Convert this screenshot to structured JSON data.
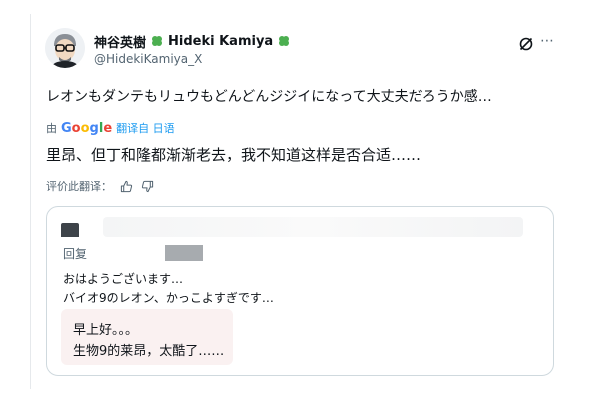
{
  "author": {
    "display_name": "神谷英樹",
    "display_name_suffix": "Hideki Kamiya",
    "handle": "@HidekiKamiya_X"
  },
  "icons": {
    "avatar": "avatar-illustration",
    "clover": "four-leaf-clover-icon",
    "grok": "grok-slash-icon",
    "more": "more-icon",
    "thumbs_up": "thumbs-up-icon",
    "thumbs_down": "thumbs-down-icon"
  },
  "post": {
    "original_text": "レオンもダンテもリュウもどんどんジジイになって大丈夫だろうか感…",
    "translate_by": "由",
    "translate_provider": "Google",
    "translate_link": "翻译自 日语",
    "translated_text": "里昂、但丁和隆都渐渐老去，我不知道这样是否合适……",
    "rate_label": "评价此翻译："
  },
  "quote": {
    "reply_label": "回复",
    "line1": "おはようございます…",
    "line2": "バイオ9のレオン、かっこよすぎです…",
    "translation_line1": "早上好。。。",
    "translation_line2": "生物9的莱昂，太酷了……"
  },
  "colors": {
    "link": "#1d9bf0",
    "secondary_text": "#536471",
    "clover_green": "#4caf50",
    "border": "#cfd9de"
  }
}
